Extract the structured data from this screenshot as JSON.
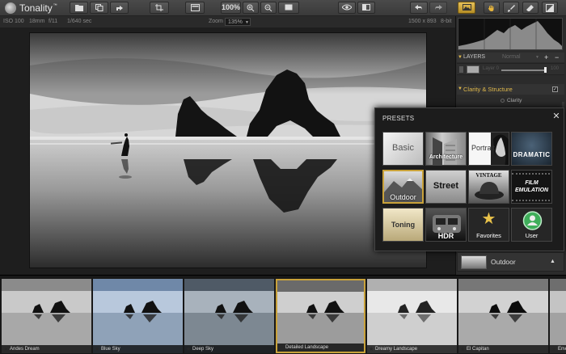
{
  "app": {
    "name": "Tonality",
    "trademark": "™"
  },
  "toolbar": {
    "zoom_label": "100%"
  },
  "info": {
    "iso": "ISO 100",
    "focal": "18mm",
    "aperture": "f/11",
    "shutter": "1/640 sec",
    "zoom_label": "Zoom",
    "zoom_value": "135%",
    "dimensions": "1500 x 893",
    "bit_depth": "8-bit"
  },
  "layers": {
    "title": "LAYERS",
    "blend_mode": "Normal",
    "layer_name": "Layer 0",
    "opacity": "100"
  },
  "clarity": {
    "title": "Clarity & Structure",
    "clarity_label": "Clarity"
  },
  "presets": {
    "title": "PRESETS",
    "close": "✕",
    "tiles": [
      {
        "label": "Basic"
      },
      {
        "label": "Architecture"
      },
      {
        "label": "Portrait"
      },
      {
        "label": "DRAMATIC"
      },
      {
        "label": "Outdoor",
        "selected": true
      },
      {
        "label": "Street"
      },
      {
        "label": "VINTAGE"
      },
      {
        "label": "FILM EMULATION"
      },
      {
        "label": "Toning"
      },
      {
        "label": "HDR"
      },
      {
        "label": "Favorites"
      },
      {
        "label": "User"
      }
    ]
  },
  "category_bar": {
    "label": "Outdoor",
    "arrow": "▲"
  },
  "filmstrip": [
    {
      "name": "Andes Dream",
      "tint": "#d8d8d8"
    },
    {
      "name": "Blue Sky",
      "tint": "#9fb4d0"
    },
    {
      "name": "Deep Sky",
      "tint": "#9aa6b0"
    },
    {
      "name": "Detailed Landscape",
      "tint": "#c8c8c8",
      "selected": true
    },
    {
      "name": "Dreamy Landscape",
      "tint": "#e6e6e6"
    },
    {
      "name": "El Capitan",
      "tint": "#cfcfcf"
    },
    {
      "name": "Envi",
      "tint": "#c0c0c0"
    }
  ],
  "colors": {
    "accent": "#d8b240",
    "selection": "#c9a23a",
    "panel": "#2b2b2b"
  }
}
